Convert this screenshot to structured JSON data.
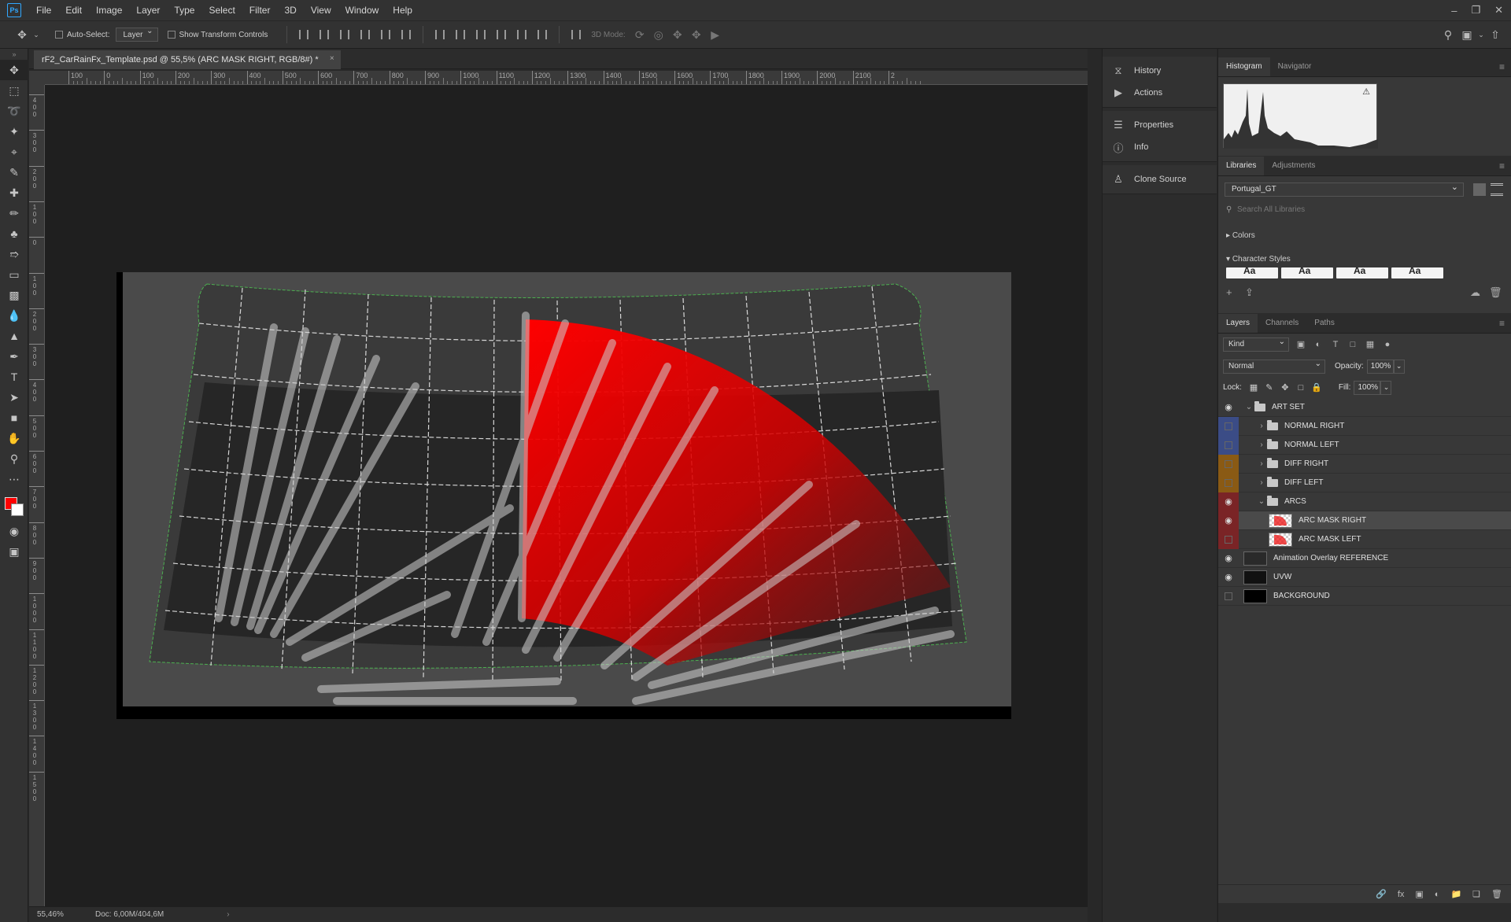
{
  "app": {
    "logo": "Ps"
  },
  "menu": [
    "File",
    "Edit",
    "Image",
    "Layer",
    "Type",
    "Select",
    "Filter",
    "3D",
    "View",
    "Window",
    "Help"
  ],
  "window_controls": {
    "minimize": "–",
    "restore": "❐",
    "close": "✕"
  },
  "options_bar": {
    "auto_select_label": "Auto-Select:",
    "auto_select_target": "Layer",
    "show_transform_label": "Show Transform Controls",
    "mode_3d_label": "3D Mode:"
  },
  "document": {
    "tab_title": "rF2_CarRainFx_Template.psd @ 55,5% (ARC MASK RIGHT, RGB/8#) *",
    "close_glyph": "×"
  },
  "ruler": {
    "top_labels": [
      "100",
      "0",
      "100",
      "200",
      "300",
      "400",
      "500",
      "600",
      "700",
      "800",
      "900",
      "1000",
      "1100",
      "1200",
      "1300",
      "1400",
      "1500",
      "1600",
      "1700",
      "1800",
      "1900",
      "2000",
      "2100",
      "2"
    ],
    "left_labels": [
      "400",
      "300",
      "200",
      "100",
      "0",
      "100",
      "200",
      "300",
      "400",
      "500",
      "600",
      "700",
      "800",
      "900",
      "1000",
      "1100",
      "1200",
      "1300",
      "1400",
      "1500"
    ]
  },
  "status": {
    "zoom": "55,46%",
    "doc": "Doc: 6,00M/404,6M",
    "arrow": "›"
  },
  "collapsed_panels": [
    {
      "label": "History",
      "icon": "history-icon",
      "glyph": "⧖"
    },
    {
      "label": "Actions",
      "icon": "play-icon",
      "glyph": "▶"
    },
    {
      "label": "Properties",
      "icon": "properties-icon",
      "glyph": "☰"
    },
    {
      "label": "Info",
      "icon": "info-icon",
      "glyph": "ⓘ"
    },
    {
      "label": "Clone Source",
      "icon": "clone-source-icon",
      "glyph": "♙"
    }
  ],
  "histogram_panel": {
    "tabs": [
      "Histogram",
      "Navigator"
    ],
    "warning": "⚠"
  },
  "libraries_panel": {
    "tabs": [
      "Libraries",
      "Adjustments"
    ],
    "library_name": "Portugal_GT",
    "search_placeholder": "Search All Libraries",
    "sections": [
      "Colors",
      "Character Styles"
    ]
  },
  "layers_panel": {
    "tabs": [
      "Layers",
      "Channels",
      "Paths"
    ],
    "kind_label": "Kind",
    "blend_mode": "Normal",
    "opacity_label": "Opacity:",
    "opacity_value": "100%",
    "lock_label": "Lock:",
    "fill_label": "Fill:",
    "fill_value": "100%",
    "layers": [
      {
        "name": "ART SET",
        "depth": 0,
        "type": "group",
        "open": true,
        "visible": true,
        "color": "none"
      },
      {
        "name": "NORMAL RIGHT",
        "depth": 1,
        "type": "group",
        "open": false,
        "visible": false,
        "color": "blue"
      },
      {
        "name": "NORMAL LEFT",
        "depth": 1,
        "type": "group",
        "open": false,
        "visible": false,
        "color": "blue"
      },
      {
        "name": "DIFF RIGHT",
        "depth": 1,
        "type": "group",
        "open": false,
        "visible": false,
        "color": "orange"
      },
      {
        "name": "DIFF LEFT",
        "depth": 1,
        "type": "group",
        "open": false,
        "visible": false,
        "color": "orange"
      },
      {
        "name": "ARCS",
        "depth": 1,
        "type": "group",
        "open": true,
        "visible": true,
        "color": "red"
      },
      {
        "name": "ARC MASK RIGHT",
        "depth": 2,
        "type": "layer",
        "thumb": "checker",
        "visible": true,
        "color": "red",
        "selected": true
      },
      {
        "name": "ARC MASK LEFT",
        "depth": 2,
        "type": "layer",
        "thumb": "checker",
        "visible": false,
        "color": "red"
      },
      {
        "name": "Animation Overlay REFERENCE",
        "depth": 0,
        "type": "layer",
        "thumb": "grid",
        "visible": true,
        "color": "none"
      },
      {
        "name": "UVW",
        "depth": 0,
        "type": "layer",
        "thumb": "dark",
        "visible": true,
        "color": "none"
      },
      {
        "name": "BACKGROUND",
        "depth": 0,
        "type": "layer",
        "thumb": "black",
        "visible": false,
        "color": "none"
      }
    ]
  },
  "colors": {
    "foreground": "#ff0000",
    "background": "#ffffff",
    "accent": "#31a8ff"
  }
}
